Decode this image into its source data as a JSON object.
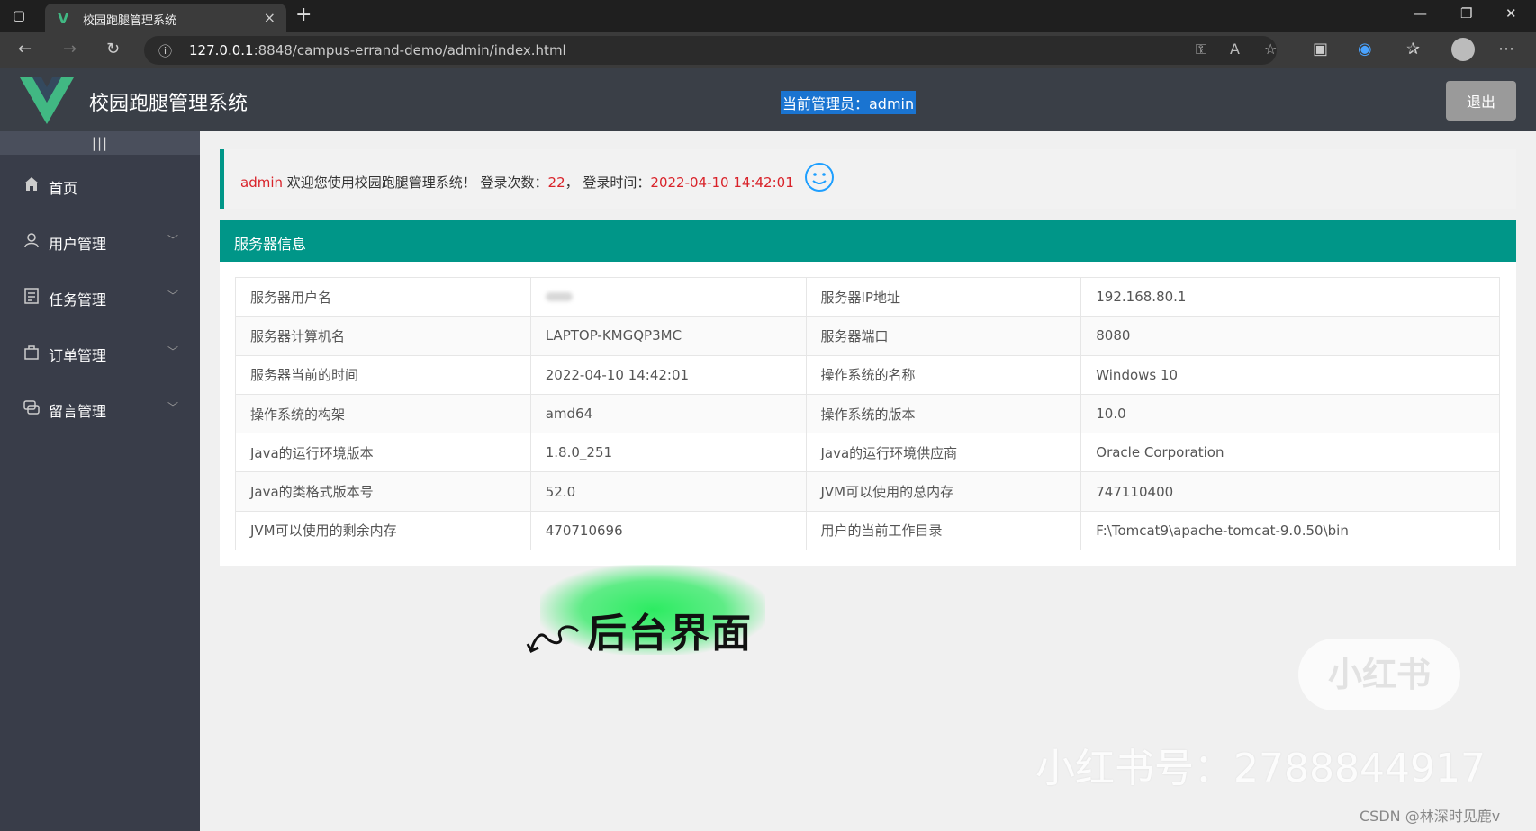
{
  "browser": {
    "tab_title": "校园跑腿管理系统",
    "url_host": "127.0.0.1",
    "url_path": ":8848/campus-errand-demo/admin/index.html"
  },
  "header": {
    "app_title": "校园跑腿管理系统",
    "admin_label": "当前管理员：admin",
    "logout_label": "退出"
  },
  "sidebar": {
    "collapse_glyph": "|||",
    "items": [
      {
        "label": "首页",
        "icon": "home-icon"
      },
      {
        "label": "用户管理",
        "icon": "user-icon"
      },
      {
        "label": "任务管理",
        "icon": "task-icon"
      },
      {
        "label": "订单管理",
        "icon": "order-icon"
      },
      {
        "label": "留言管理",
        "icon": "message-icon"
      }
    ]
  },
  "welcome": {
    "user": "admin",
    "text1": " 欢迎您使用校园跑腿管理系统！ 登录次数：",
    "count": "22",
    "text2": "， 登录时间：",
    "time": "2022-04-10 14:42:01"
  },
  "server": {
    "title": "服务器信息",
    "rows": [
      [
        "服务器用户名",
        "",
        "服务器IP地址",
        "192.168.80.1"
      ],
      [
        "服务器计算机名",
        "LAPTOP-KMGQP3MC",
        "服务器端口",
        "8080"
      ],
      [
        "服务器当前的时间",
        "2022-04-10 14:42:01",
        "操作系统的名称",
        "Windows 10"
      ],
      [
        "操作系统的构架",
        "amd64",
        "操作系统的版本",
        "10.0"
      ],
      [
        "Java的运行环境版本",
        "1.8.0_251",
        "Java的运行环境供应商",
        "Oracle Corporation"
      ],
      [
        "Java的类格式版本号",
        "52.0",
        "JVM可以使用的总内存",
        "747110400"
      ],
      [
        "JVM可以使用的剩余内存",
        "470710696",
        "用户的当前工作目录",
        "F:\\Tomcat9\\apache-tomcat-9.0.50\\bin"
      ]
    ]
  },
  "overlay": {
    "caption": "后台界面",
    "badge": "小红书",
    "number": "小红书号：2788844917",
    "credit": "CSDN @林深时见鹿v"
  },
  "colors": {
    "accent": "#009688",
    "header_bg": "#3a3f47",
    "sidebar_bg": "#393d49",
    "highlight": "#d9232a"
  }
}
